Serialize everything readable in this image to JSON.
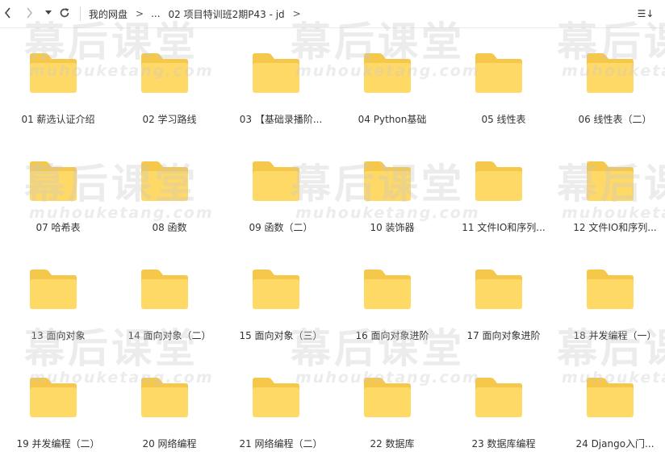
{
  "toolbar": {
    "back_icon": "chevron-left-icon",
    "forward_icon": "chevron-right-icon",
    "history_icon": "caret-down-icon",
    "refresh_icon": "refresh-icon",
    "view_label": "☰↓"
  },
  "breadcrumb": {
    "root": "我的网盘",
    "ellipsis": "...",
    "current": "02 项目特训班2期P43 - jd",
    "separator": ">"
  },
  "watermark": {
    "main": "幕后课堂",
    "sub": "muhouketang.com"
  },
  "folders": [
    {
      "name": "01 薪选认证介绍"
    },
    {
      "name": "02 学习路线"
    },
    {
      "name": "03 【基础录播阶..."
    },
    {
      "name": "04 Python基础"
    },
    {
      "name": "05 线性表"
    },
    {
      "name": "06 线性表（二）"
    },
    {
      "name": "07 哈希表"
    },
    {
      "name": "08 函数"
    },
    {
      "name": "09 函数（二）"
    },
    {
      "name": "10 装饰器"
    },
    {
      "name": "11 文件IO和序列..."
    },
    {
      "name": "12 文件IO和序列..."
    },
    {
      "name": "13 面向对象"
    },
    {
      "name": "14 面向对象（二）"
    },
    {
      "name": "15 面向对象（三）"
    },
    {
      "name": "16 面向对象进阶"
    },
    {
      "name": "17 面向对象进阶"
    },
    {
      "name": "18 并发编程（一）"
    },
    {
      "name": "19 并发编程（二）"
    },
    {
      "name": "20 网络编程"
    },
    {
      "name": "21 网络编程（二）"
    },
    {
      "name": "22 数据库"
    },
    {
      "name": "23 数据库编程"
    },
    {
      "name": "24 Django入门..."
    }
  ],
  "colors": {
    "folder_back": "#F5C84C",
    "folder_front": "#FFD966",
    "text": "#333333"
  }
}
